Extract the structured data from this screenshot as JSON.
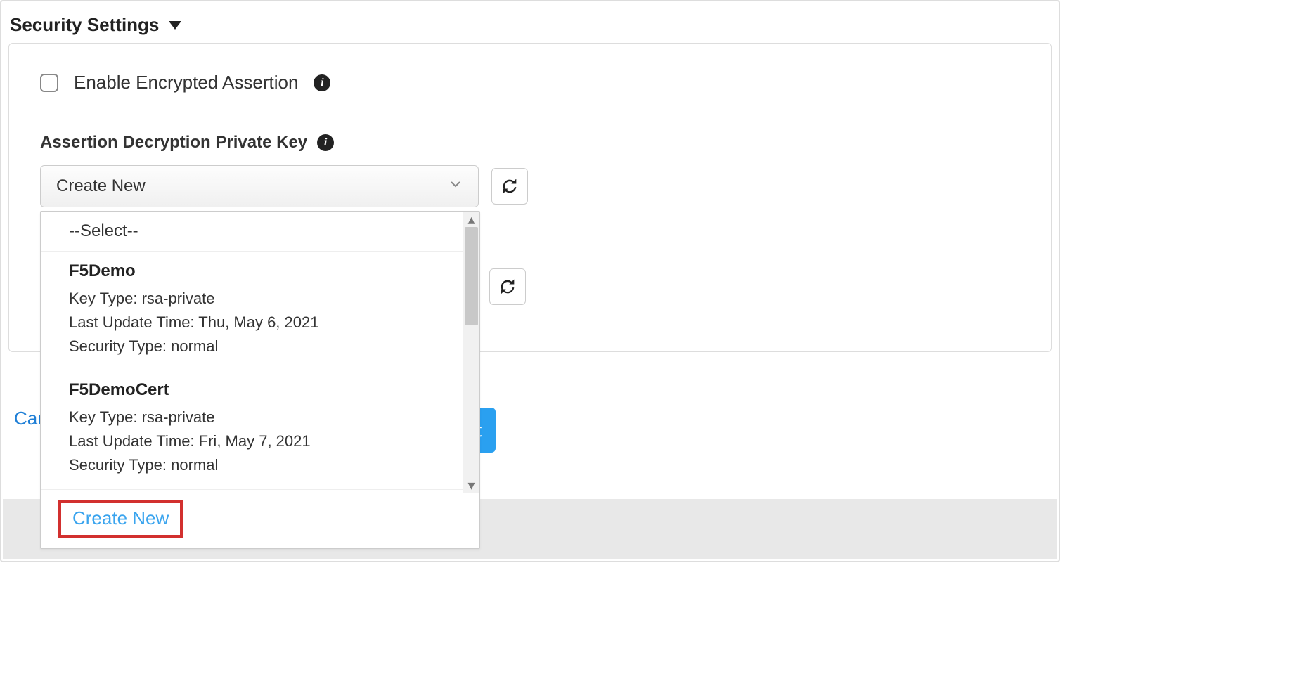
{
  "section": {
    "title": "Security Settings"
  },
  "checkbox": {
    "label": "Enable Encrypted Assertion"
  },
  "field": {
    "label": "Assertion Decryption Private Key"
  },
  "select": {
    "value": "Create New"
  },
  "dropdown": {
    "placeholder": "--Select--",
    "items": [
      {
        "name": "F5Demo",
        "keyTypeLabel": "Key Type:",
        "keyType": "rsa-private",
        "lastUpdateLabel": "Last Update Time:",
        "lastUpdate": "Thu, May 6, 2021",
        "securityTypeLabel": "Security Type:",
        "securityType": "normal"
      },
      {
        "name": "F5DemoCert",
        "keyTypeLabel": "Key Type:",
        "keyType": "rsa-private",
        "lastUpdateLabel": "Last Update Time:",
        "lastUpdate": "Fri, May 7, 2021",
        "securityTypeLabel": "Security Type:",
        "securityType": "normal"
      }
    ],
    "createNew": "Create New"
  },
  "footer": {
    "cancel": "Can",
    "nextFragment": "t"
  }
}
